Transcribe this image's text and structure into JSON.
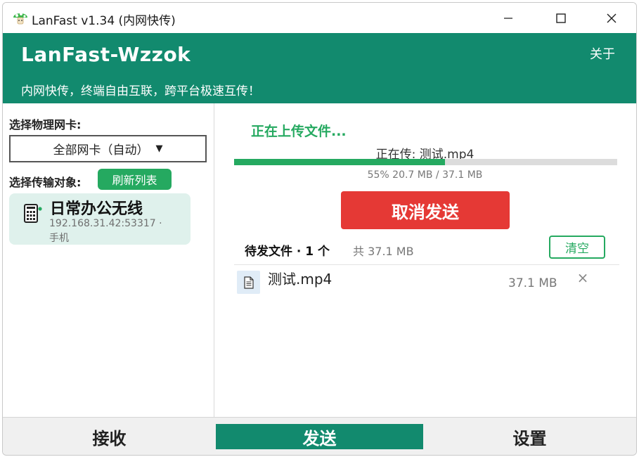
{
  "window": {
    "title": "LanFast v1.34 (内网快传)",
    "minimize_icon": "minimize-icon",
    "maximize_icon": "maximize-icon",
    "close_icon": "close-icon"
  },
  "header": {
    "title": "LanFast-Wzzok",
    "about": "关于",
    "subtitle": "内网快传，终端自由互联，跨平台极速互传！"
  },
  "left_panel": {
    "nic_label": "选择物理网卡:",
    "nic_selected": "全部网卡（自动）",
    "nic_arrow": "▼",
    "target_label": "选择传输对象:",
    "refresh_label": "刷新列表",
    "devices": [
      {
        "icon": "phone-device-icon",
        "name": "日常办公无线",
        "address": "192.168.31.42:53317 ·",
        "type": "手机",
        "online_color": "#25a960"
      }
    ]
  },
  "transfer": {
    "status": "正在上传文件...",
    "current_file": "正在传: 测试.mp4",
    "progress_percent": 55,
    "progress_text": "55%   20.7 MB / 37.1 MB",
    "cancel_label": "取消发送"
  },
  "queue": {
    "title": "待发文件 · 1 个",
    "total": "共 37.1 MB",
    "clear_label": "清空",
    "files": [
      {
        "icon": "document-icon",
        "name": "测试.mp4",
        "size": "37.1 MB",
        "remove": "×"
      }
    ]
  },
  "bottom_nav": {
    "receive": "接收",
    "send": "发送",
    "settings": "设置",
    "active": "send"
  },
  "colors": {
    "brand": "#128a6e",
    "accent_green": "#25a960",
    "danger": "#e53935",
    "device_card_bg": "#dff1ec"
  }
}
